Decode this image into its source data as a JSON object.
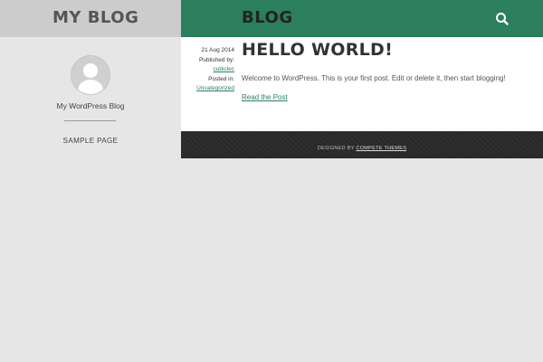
{
  "site": {
    "title": "MY BLOG",
    "tagline": "My WordPress Blog"
  },
  "header": {
    "section_title": "BLOG",
    "search_icon": "search-icon"
  },
  "sidebar": {
    "avatar_icon": "user-avatar-icon",
    "nav": [
      {
        "label": "SAMPLE PAGE"
      }
    ]
  },
  "post": {
    "date": "21 Aug 2014",
    "published_by_label": "Published by:",
    "author": "cubiclec",
    "posted_in_label": "Posted in:",
    "category": "Uncategorized",
    "title": "HELLO WORLD!",
    "excerpt": "Welcome to WordPress. This is your first post. Edit or delete it, then start blogging!",
    "read_more": "Read the Post"
  },
  "footer": {
    "designed_by": "DESIGNED BY",
    "theme_link": "COMPETE THEMES"
  },
  "colors": {
    "accent": "#2b7f5c",
    "footer_bg": "#2a2a2a",
    "sidebar_bg": "#e6e6e6",
    "sidebar_header_bg": "#cccccc"
  }
}
